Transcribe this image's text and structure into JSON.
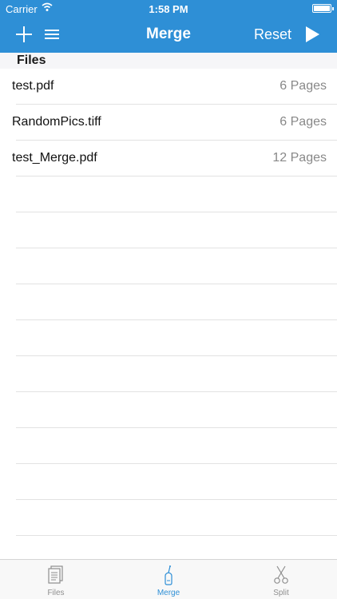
{
  "status_bar": {
    "carrier": "Carrier",
    "time": "1:58 PM",
    "wifi_icon": "wifi-icon",
    "battery_icon": "battery-icon"
  },
  "nav": {
    "title": "Merge",
    "reset_label": "Reset",
    "add_icon": "plus-icon",
    "menu_icon": "list-icon",
    "play_icon": "play-icon"
  },
  "section": {
    "title": "Files"
  },
  "files": [
    {
      "name": "test.pdf",
      "pages": "6 Pages"
    },
    {
      "name": "RandomPics.tiff",
      "pages": "6 Pages"
    },
    {
      "name": "test_Merge.pdf",
      "pages": "12 Pages"
    }
  ],
  "tabs": [
    {
      "label": "Files",
      "icon": "document-icon",
      "active": false
    },
    {
      "label": "Merge",
      "icon": "merge-icon",
      "active": true
    },
    {
      "label": "Split",
      "icon": "scissors-icon",
      "active": false
    }
  ],
  "colors": {
    "accent": "#2e8fd6",
    "tab_inactive": "#8e8e8e"
  }
}
